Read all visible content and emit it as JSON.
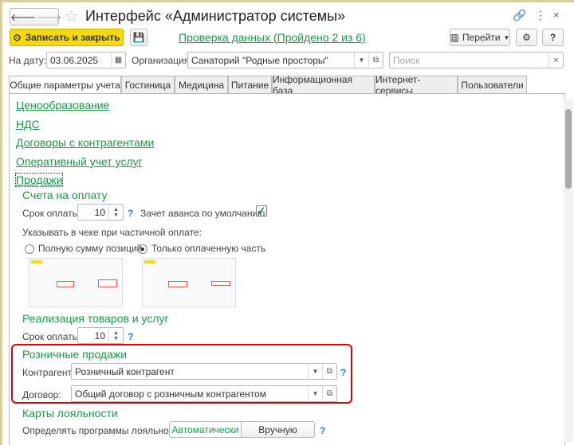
{
  "window": {
    "title": "Интерфейс «Администратор системы»"
  },
  "toolbar": {
    "save_close": "Записать и закрыть",
    "check_link": "Проверка данных (Пройдено 2 из 6)",
    "goto": "Перейти",
    "help": "?"
  },
  "filters": {
    "date_label": "На дату:",
    "date_value": "03.06.2025",
    "org_label": "Организация:",
    "org_value": "Санаторий \"Родные просторы\"",
    "search_placeholder": "Поиск"
  },
  "tabs": [
    {
      "label": "Общие параметры учета",
      "active": true
    },
    {
      "label": "Гостиница"
    },
    {
      "label": "Медицина"
    },
    {
      "label": "Питание"
    },
    {
      "label": "Информационная база"
    },
    {
      "label": "Интернет-сервисы"
    },
    {
      "label": "Пользователи"
    }
  ],
  "links": [
    "Ценообразование",
    "НДС",
    "Договоры с контрагентами",
    "Оперативный учет услуг",
    "Продажи"
  ],
  "invoices": {
    "title": "Счета на оплату",
    "term_label": "Срок оплаты:",
    "term_value": "10",
    "advance_label": "Зачет аванса по умолчанию:",
    "advance_checked": true,
    "receipt_label": "Указывать в чеке при частичной оплате:",
    "options": [
      "Полную сумму позиций",
      "Только оплаченную часть"
    ],
    "selected": 1
  },
  "realization": {
    "title": "Реализация товаров и услуг",
    "term_label": "Срок оплаты:",
    "term_value": "10"
  },
  "retail": {
    "title": "Розничные продажи",
    "contractor_label": "Контрагент:",
    "contractor_value": "Розничный контрагент",
    "contract_label": "Договор:",
    "contract_value": "Общий договор с розничным контрагентом"
  },
  "loyalty": {
    "title": "Карты лояльности",
    "label": "Определять программы лояльности:",
    "options": [
      "Автоматически",
      "Вручную"
    ],
    "selected": 0
  },
  "colors": {
    "accent": "#1a9a4a",
    "highlight": "#e00000",
    "primary_button": "#f5d90a"
  }
}
